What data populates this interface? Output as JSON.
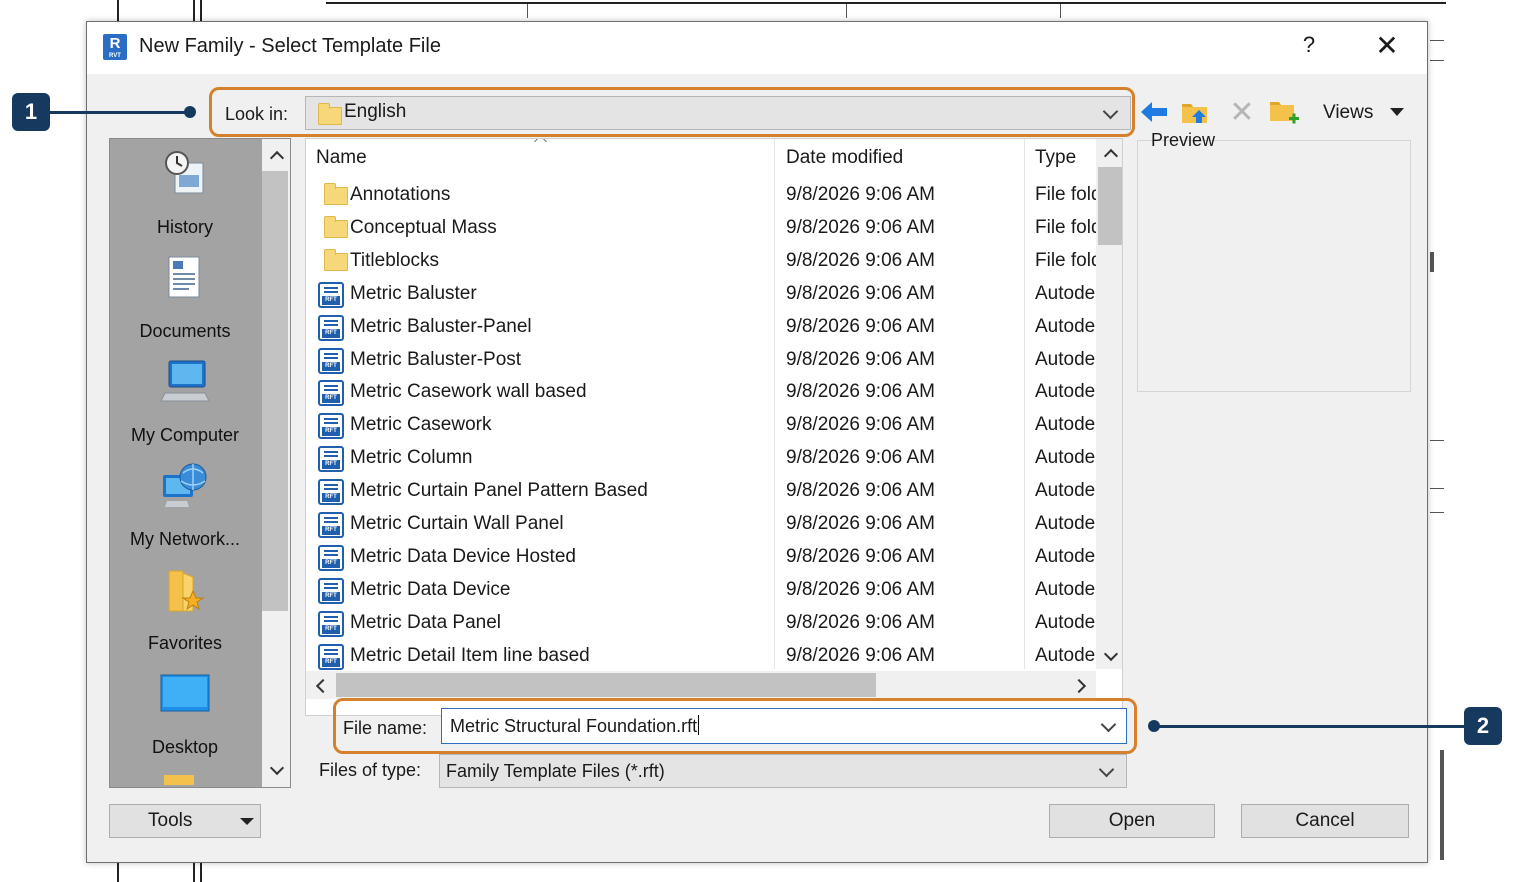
{
  "dialog": {
    "title": "New Family - Select Template File",
    "app_icon_letter": "R",
    "app_icon_sub": "RVT",
    "help": "?",
    "close": "✕"
  },
  "lookin": {
    "label": "Look in:",
    "value": "English"
  },
  "toolbar": {
    "views_label": "Views",
    "preview_label": "Preview"
  },
  "places": [
    {
      "label": "History",
      "icon": "history-icon"
    },
    {
      "label": "Documents",
      "icon": "documents-icon"
    },
    {
      "label": "My Computer",
      "icon": "computer-icon"
    },
    {
      "label": "My Network...",
      "icon": "network-icon"
    },
    {
      "label": "Favorites",
      "icon": "favorites-icon"
    },
    {
      "label": "Desktop",
      "icon": "desktop-icon"
    }
  ],
  "columns": {
    "name": "Name",
    "date": "Date modified",
    "type": "Type"
  },
  "files": [
    {
      "name": "Annotations",
      "date": "9/8/2026 9:06 AM",
      "type": "File folder",
      "kind": "folder"
    },
    {
      "name": "Conceptual Mass",
      "date": "9/8/2026 9:06 AM",
      "type": "File folder",
      "kind": "folder"
    },
    {
      "name": "Titleblocks",
      "date": "9/8/2026 9:06 AM",
      "type": "File folder",
      "kind": "folder"
    },
    {
      "name": "Metric Baluster",
      "date": "9/8/2026 9:06 AM",
      "type": "Autodesk",
      "kind": "rft"
    },
    {
      "name": "Metric Baluster-Panel",
      "date": "9/8/2026 9:06 AM",
      "type": "Autodesk",
      "kind": "rft"
    },
    {
      "name": "Metric Baluster-Post",
      "date": "9/8/2026 9:06 AM",
      "type": "Autodesk",
      "kind": "rft"
    },
    {
      "name": "Metric Casework wall based",
      "date": "9/8/2026 9:06 AM",
      "type": "Autodesk",
      "kind": "rft"
    },
    {
      "name": "Metric Casework",
      "date": "9/8/2026 9:06 AM",
      "type": "Autodesk",
      "kind": "rft"
    },
    {
      "name": "Metric Column",
      "date": "9/8/2026 9:06 AM",
      "type": "Autodesk",
      "kind": "rft"
    },
    {
      "name": "Metric Curtain Panel Pattern Based",
      "date": "9/8/2026 9:06 AM",
      "type": "Autodesk",
      "kind": "rft"
    },
    {
      "name": "Metric Curtain Wall Panel",
      "date": "9/8/2026 9:06 AM",
      "type": "Autodesk",
      "kind": "rft"
    },
    {
      "name": "Metric Data Device Hosted",
      "date": "9/8/2026 9:06 AM",
      "type": "Autodesk",
      "kind": "rft"
    },
    {
      "name": "Metric Data Device",
      "date": "9/8/2026 9:06 AM",
      "type": "Autodesk",
      "kind": "rft"
    },
    {
      "name": "Metric Data Panel",
      "date": "9/8/2026 9:06 AM",
      "type": "Autodesk",
      "kind": "rft"
    },
    {
      "name": "Metric Detail Item line based",
      "date": "9/8/2026 9:06 AM",
      "type": "Autodesk",
      "kind": "rft"
    }
  ],
  "filename": {
    "label": "File name:",
    "value": "Metric Structural Foundation.rft"
  },
  "filetype": {
    "label": "Files of type:",
    "value": "Family Template Files (*.rft)"
  },
  "buttons": {
    "tools": "Tools",
    "open": "Open",
    "cancel": "Cancel"
  },
  "callouts": {
    "one": "1",
    "two": "2"
  },
  "colors": {
    "highlight": "#d5802d",
    "callout": "#163a5f",
    "accent": "#2e6fc2"
  }
}
